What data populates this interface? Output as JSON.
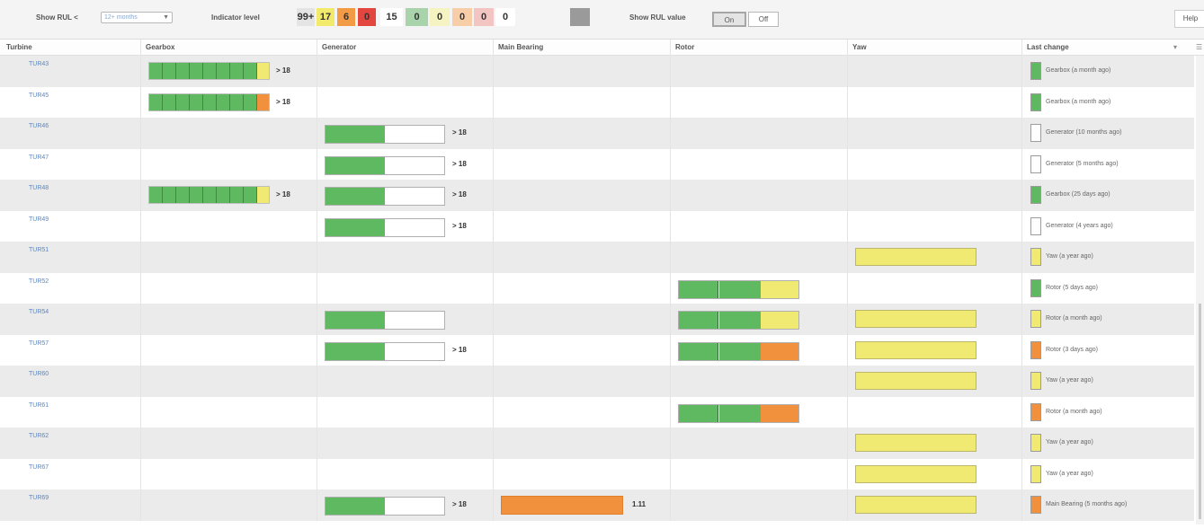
{
  "toolbar": {
    "rul_label": "Show RUL <",
    "rul_value": "12+ months",
    "indicator_label": "Indicator level",
    "levels": [
      {
        "text": "99+",
        "color": "#e4e4e4"
      },
      {
        "text": "17",
        "color": "#f2ea6c"
      },
      {
        "text": "6",
        "color": "#f39a45"
      },
      {
        "text": "0",
        "color": "#e2463f"
      },
      {
        "text": "15",
        "color": "#ffffff"
      },
      {
        "text": "0",
        "color": "#a9d3ab"
      },
      {
        "text": "0",
        "color": "#f6f3c2"
      },
      {
        "text": "0",
        "color": "#f8cea8"
      },
      {
        "text": "0",
        "color": "#f2c5c2"
      },
      {
        "text": "0",
        "color": "#ffffff"
      },
      {
        "text": "",
        "color": "#9a9a9a"
      }
    ],
    "show_rul_value_label": "Show RUL value",
    "on_label": "On",
    "off_label": "Off",
    "help_label": "Help"
  },
  "columns": [
    "Turbine",
    "Gearbox",
    "Generator",
    "Main Bearing",
    "Rotor",
    "Yaw",
    "Last change"
  ],
  "colors": {
    "green": "#5fb961",
    "yellow": "#f1ea72",
    "orange": "#f2913d",
    "white": "#ffffff",
    "turbine_link": "#5b86c0"
  },
  "rows": [
    {
      "turbine": "TUR43",
      "gearbox": {
        "tail": "yellow",
        "rul": "> 18"
      },
      "last_change": {
        "color": "green",
        "text": "Gearbox (a month ago)"
      }
    },
    {
      "turbine": "TUR45",
      "gearbox": {
        "tail": "orange",
        "rul": "> 18"
      },
      "last_change": {
        "color": "green",
        "text": "Gearbox (a month ago)"
      }
    },
    {
      "turbine": "TUR46",
      "generator": {
        "level": 0.5,
        "rul": "> 18"
      },
      "last_change": {
        "color": "white",
        "text": "Generator (10 months ago)"
      }
    },
    {
      "turbine": "TUR47",
      "generator": {
        "level": 0.5,
        "rul": "> 18"
      },
      "last_change": {
        "color": "white",
        "text": "Generator (5 months ago)"
      }
    },
    {
      "turbine": "TUR48",
      "gearbox": {
        "tail": "yellow",
        "rul": "> 18"
      },
      "generator": {
        "level": 0.5,
        "rul": "> 18"
      },
      "last_change": {
        "color": "green",
        "text": "Gearbox (25 days ago)"
      }
    },
    {
      "turbine": "TUR49",
      "generator": {
        "level": 0.5,
        "rul": "> 18"
      },
      "last_change": {
        "color": "white",
        "text": "Generator (4 years ago)"
      }
    },
    {
      "turbine": "TUR51",
      "yaw": true,
      "last_change": {
        "color": "yellow",
        "text": "Yaw (a year ago)"
      }
    },
    {
      "turbine": "TUR52",
      "rotor": {
        "tail": "yellow"
      },
      "last_change": {
        "color": "green",
        "text": "Rotor (5 days ago)"
      }
    },
    {
      "turbine": "TUR54",
      "generator": {
        "level": 0.5
      },
      "rotor": {
        "tail": "yellow"
      },
      "yaw": true,
      "last_change": {
        "color": "yellow",
        "text": "Rotor (a month ago)"
      }
    },
    {
      "turbine": "TUR57",
      "generator": {
        "level": 0.5,
        "rul": "> 18"
      },
      "rotor": {
        "tail": "orange"
      },
      "yaw": true,
      "last_change": {
        "color": "orange",
        "text": "Rotor (3 days ago)"
      }
    },
    {
      "turbine": "TUR60",
      "yaw": true,
      "last_change": {
        "color": "yellow",
        "text": "Yaw (a year ago)"
      }
    },
    {
      "turbine": "TUR61",
      "rotor": {
        "tail": "orange"
      },
      "last_change": {
        "color": "orange",
        "text": "Rotor (a month ago)"
      }
    },
    {
      "turbine": "TUR62",
      "yaw": true,
      "last_change": {
        "color": "yellow",
        "text": "Yaw (a year ago)"
      }
    },
    {
      "turbine": "TUR67",
      "yaw": true,
      "last_change": {
        "color": "yellow",
        "text": "Yaw (a year ago)"
      }
    },
    {
      "turbine": "TUR69",
      "generator": {
        "level": 0.5,
        "rul": "> 18"
      },
      "main_bearing": {
        "rul": "1.11"
      },
      "yaw": true,
      "last_change": {
        "color": "orange",
        "text": "Main Bearing (5 months ago)"
      }
    }
  ]
}
